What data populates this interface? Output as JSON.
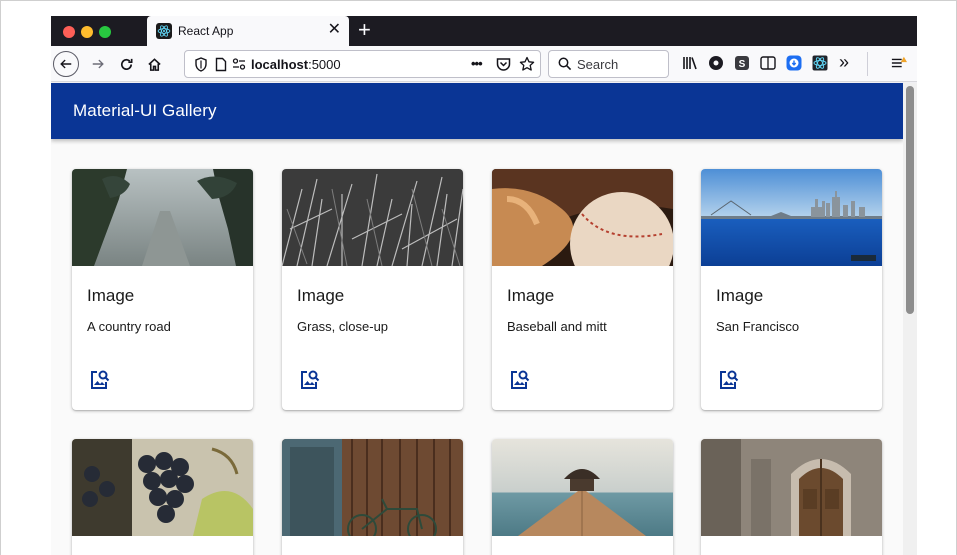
{
  "browser": {
    "tab_title": "React App",
    "new_tab_symbol": "+",
    "close_symbol": "✕",
    "url_host": "localhost",
    "url_port": ":5000",
    "search_placeholder": "Search",
    "overflow_symbol": "»",
    "page_actions_symbol": "•••"
  },
  "app": {
    "title": "Material-UI Gallery",
    "accent_color": "#0a3595"
  },
  "cards": [
    {
      "title": "Image",
      "description": "A country road",
      "image": "country-road"
    },
    {
      "title": "Image",
      "description": "Grass, close-up",
      "image": "grass"
    },
    {
      "title": "Image",
      "description": "Baseball and mitt",
      "image": "baseball"
    },
    {
      "title": "Image",
      "description": "San Francisco",
      "image": "san-francisco"
    },
    {
      "title": "",
      "description": "",
      "image": "grapes"
    },
    {
      "title": "",
      "description": "",
      "image": "bicycle-door"
    },
    {
      "title": "",
      "description": "",
      "image": "pier"
    },
    {
      "title": "",
      "description": "",
      "image": "wooden-door"
    }
  ]
}
